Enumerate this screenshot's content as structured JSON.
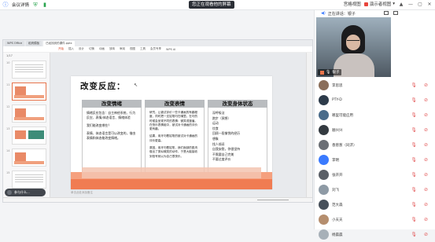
{
  "topbar": {
    "title": "会议详情",
    "share_banner": "您正在观看他的屏幕",
    "pin_label": "宫格视图",
    "menu_label": "演示者视图",
    "menu_caret": "▾",
    "pin_text": "▲",
    "win_min": "—",
    "win_max": "▢",
    "win_close": "✕"
  },
  "shared_window": {
    "tabs": [
      "WPS Office",
      "稻壳模板",
      "已经找到的课件.pptx"
    ],
    "menu": [
      "开始",
      "插入",
      "设计",
      "切换",
      "动画",
      "放映",
      "审阅",
      "视图",
      "工具",
      "会员专享",
      "WPS AI"
    ],
    "thumb_header": "1/17",
    "thumb_numbers": [
      "10",
      "11",
      "12",
      "13",
      "14",
      "15"
    ],
    "chat_preview": "参与什么...",
    "page_note": "单击此处添加备注"
  },
  "slide": {
    "title": "改变反应：",
    "columns": [
      {
        "header": "改变情绪",
        "paragraphs": [
          "情绪反应包含：自主神经系统、行为反应、表情/体态语言、情绪体验",
          "我们能改变哪些？",
          "表情、体态语言是可以改变的，借由表情和体态能改变情绪。"
        ]
      },
      {
        "header": "改变表情",
        "paragraphs": [
          "研究，让被试评价一些卡通画的有趣程度，同时把一支铅笔叼在嘴里。在叼的时候会呈现不同的表情：微笑或皱眉。在快乐表情组中，被试对卡通画的评价更有趣。",
          "结果，用牙叼着铅笔的被试对卡通画的评价更高。",
          "原因，用牙叼着铅笔，我们面部的肌肉做出了类似微笑的动作，于是大脑接收到信号就以为自己很快乐。"
        ]
      },
      {
        "header": "改变身体状态",
        "paragraphs": [
          "深呼吸法",
          "跑步（冥想）",
          "运动",
          "饮食",
          "回顾一段愉悦的经历",
          "想象",
          "找人倾诉",
          "自我安慰，你很坚持",
          "不需要自己完美",
          "不要过度评价"
        ]
      }
    ]
  },
  "panel": {
    "speaking_label": "正在讲话：",
    "speaker": "银子",
    "video_name": "银子",
    "participants": [
      {
        "name": "李思思",
        "color": "#8a6e5b"
      },
      {
        "name": "PTY-D",
        "color": "#2d3b4a"
      },
      {
        "name": "哪里可能应用",
        "color": "#4a6b8a"
      },
      {
        "name": "顺兴兴",
        "color": "#333a40"
      },
      {
        "name": "香葱葱（同济）",
        "color": "#6b6f75"
      },
      {
        "name": "李明",
        "color": "#3a7afe"
      },
      {
        "name": "张开开",
        "color": "#5a5f66"
      },
      {
        "name": "刘飞",
        "color": "#8e9aa5"
      },
      {
        "name": "范大森",
        "color": "#47505a"
      },
      {
        "name": "小天天",
        "color": "#b58e6e"
      },
      {
        "name": "杨晨晨",
        "color": "#a7b0b8"
      }
    ]
  },
  "colors": {
    "accent": "#f07c52",
    "accent_light": "#f5a07e",
    "header_gray": "#b9bcbf",
    "mic_muted": "#e25555",
    "brand_blue": "#3a7afe"
  }
}
